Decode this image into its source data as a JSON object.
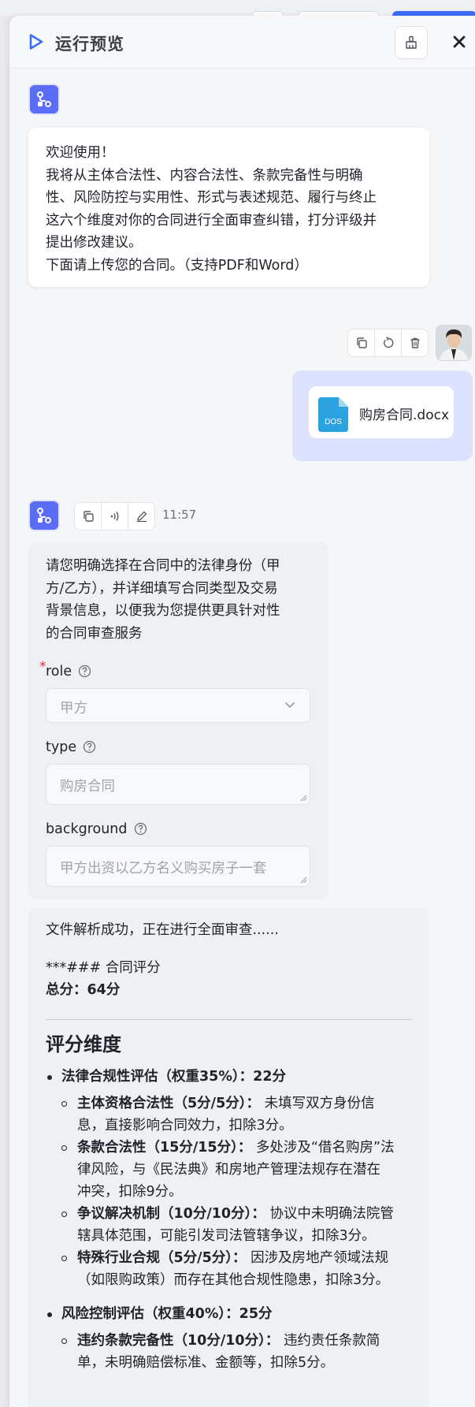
{
  "header": {
    "title": "运行预览"
  },
  "welcome": {
    "lines": [
      "欢迎使用！",
      "我将从主体合法性、内容合法性、条款完备性与明确",
      "性、风险防控与实用性、形式与表述规范、履行与终止",
      "这六个维度对你的合同进行全面审查纠错，打分评级并",
      "提出修改建议。",
      "下面请上传您的合同。（支持PDF和Word）"
    ]
  },
  "user_message": {
    "file_name": "购房合同.docx",
    "file_type": "DOS"
  },
  "bot_reply": {
    "time": "11:57",
    "intro_lines": [
      "请您明确选择在合同中的法律身份（甲",
      "方/乙方），并详细填写合同类型及交易",
      "背景信息，以便我为您提供更具针对性",
      "的合同审查服务"
    ],
    "fields": {
      "role": {
        "label": "role",
        "required_mark": "*",
        "value": "甲方"
      },
      "type": {
        "label": "type",
        "value": "购房合同"
      },
      "background": {
        "label": "background",
        "value": "甲方出资以乙方名义购买房子一套"
      }
    }
  },
  "result": {
    "line1": "文件解析成功，正在进行全面审查......",
    "line2": "***### 合同评分",
    "total": "总分：64分",
    "heading": "评分维度",
    "items": [
      {
        "title": "法律合规性评估（权重35%）：22分"
      },
      {
        "title": "风险控制评估（权重40%）：25分"
      }
    ],
    "sub1": [
      {
        "bold": "主体资格合法性（5分/5分）：",
        "l1": "未填写双方身份信",
        "l2": "息，直接影响合同效力，扣除3分。"
      },
      {
        "bold": "条款合法性（15分/15分）：",
        "l1": "多处涉及“借名购房”法",
        "l2": "律风险，与《民法典》和房地产管理法规存在潜在",
        "l3": "冲突，扣除9分。"
      },
      {
        "bold": "争议解决机制（10分/10分）：",
        "l1": "协议中未明确法院管",
        "l2": "辖具体范围，可能引发司法管辖争议，扣除3分。"
      },
      {
        "bold": "特殊行业合规（5分/5分）：",
        "l1": "因涉及房地产领域法规",
        "l2": "（如限购政策）而存在其他合规性隐患，扣除3分。"
      }
    ],
    "sub2": [
      {
        "bold": "违约条款完备性（10分/10分）：",
        "l1": "违约责任条款简",
        "l2": "单，未明确赔偿标准、金额等，扣除5分。"
      }
    ]
  }
}
